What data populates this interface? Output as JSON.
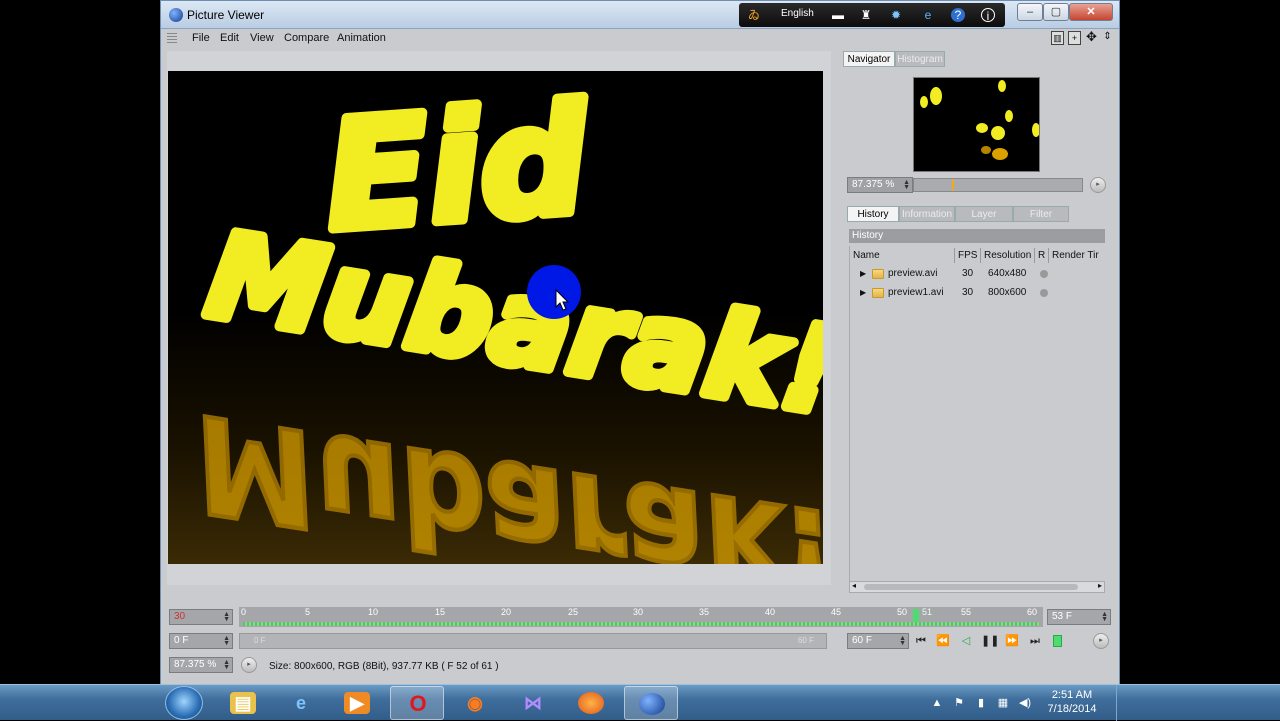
{
  "window": {
    "title": "Picture Viewer"
  },
  "tray_toolbar": {
    "language": "English"
  },
  "menu": {
    "items": [
      "File",
      "Edit",
      "View",
      "Compare",
      "Animation"
    ]
  },
  "image": {
    "line1": "Eid",
    "line2": "Mubarak!",
    "text_color": "#f2ec22",
    "background_color": "#000000",
    "reflection_color": "#d9a000"
  },
  "navigator": {
    "tabs": [
      "Navigator",
      "Histogram"
    ],
    "zoom": "87.375 %"
  },
  "history_panel": {
    "tabs": [
      "History",
      "Information",
      "Layer",
      "Filter"
    ],
    "header": "History",
    "columns": [
      "Name",
      "FPS",
      "Resolution",
      "R",
      "Render Tir"
    ],
    "rows": [
      {
        "name": "preview.avi",
        "fps": "30",
        "resolution": "640x480"
      },
      {
        "name": "preview1.avi",
        "fps": "30",
        "resolution": "800x600"
      }
    ]
  },
  "timeline": {
    "current_frame_field": "30",
    "ticks": [
      "0",
      "5",
      "10",
      "15",
      "20",
      "25",
      "30",
      "35",
      "40",
      "45",
      "50",
      "51",
      "55",
      "60"
    ],
    "end_frame": "53 F",
    "start_field": "0 F",
    "range_start": "0 F",
    "range_end": "60 F",
    "fps_field": "60 F",
    "progress_fraction": 0.85
  },
  "status": {
    "zoom": "87.375 %",
    "info": "Size: 800x600, RGB (8Bit), 937.77 KB ( F 52 of 61 )"
  },
  "taskbar": {
    "time": "2:51 AM",
    "date": "7/18/2014"
  }
}
